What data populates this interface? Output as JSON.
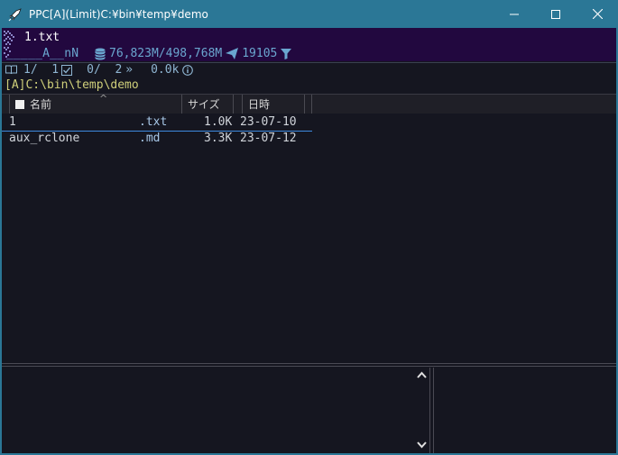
{
  "window": {
    "title": "PPC[A](Limit)C:¥bin¥temp¥demo",
    "app_icon": "rocket-icon",
    "buttons": [
      "minimize",
      "maximize",
      "close"
    ]
  },
  "info": {
    "filename": "1.txt",
    "attributes": "_____A__nN",
    "disk": "76,823M/498,768M",
    "extra": "19105"
  },
  "status": {
    "book_icon": "book-icon",
    "position": "1/  1",
    "marked": "0/  2",
    "size": "0.0k",
    "info_icon": "info-icon"
  },
  "path": "[A]C:\\bin\\temp\\demo",
  "columns": {
    "name": "名前",
    "size": "サイズ",
    "date": "日時"
  },
  "files": [
    {
      "name": "1",
      "ext": ".txt",
      "size": "1.0K",
      "date": "23-07-10"
    },
    {
      "name": "aux_rclone",
      "ext": ".md",
      "size": "3.3K",
      "date": "23-07-12"
    }
  ],
  "colors": {
    "titlebar": "#2b7796",
    "background": "#151620",
    "info_background": "#22083f",
    "cursor_line": "#3d8ae0"
  }
}
